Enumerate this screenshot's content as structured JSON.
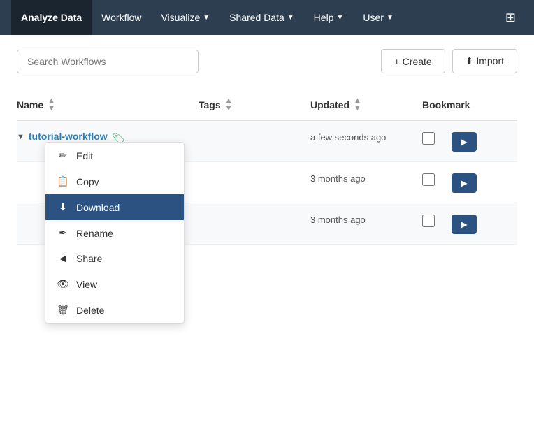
{
  "navbar": {
    "items": [
      {
        "label": "Analyze Data",
        "active": true
      },
      {
        "label": "Workflow",
        "active": false
      },
      {
        "label": "Visualize",
        "dropdown": true,
        "active": false
      },
      {
        "label": "Shared Data",
        "dropdown": true,
        "active": false
      },
      {
        "label": "Help",
        "dropdown": true,
        "active": false
      },
      {
        "label": "User",
        "dropdown": true,
        "active": false
      }
    ]
  },
  "toolbar": {
    "search_placeholder": "Search Workflows",
    "create_label": "+ Create",
    "import_label": "⬆ Import"
  },
  "table": {
    "columns": [
      {
        "label": "Name"
      },
      {
        "label": "Tags"
      },
      {
        "label": "Updated"
      },
      {
        "label": "Bookmark"
      }
    ],
    "rows": [
      {
        "name": "tutorial-workflow",
        "tags": "",
        "updated": "a few seconds ago",
        "bookmark": false
      },
      {
        "name": "",
        "tags": "",
        "updated": "3 months ago",
        "bookmark": false
      },
      {
        "name": "",
        "tags": "",
        "updated": "3 months ago",
        "bookmark": false
      }
    ]
  },
  "dropdown": {
    "items": [
      {
        "label": "Edit",
        "icon": "✏",
        "active": false
      },
      {
        "label": "Copy",
        "icon": "📋",
        "active": false
      },
      {
        "label": "Download",
        "icon": "⬇",
        "active": true
      },
      {
        "label": "Rename",
        "icon": "✒",
        "active": false
      },
      {
        "label": "Share",
        "icon": "◀",
        "active": false
      },
      {
        "label": "View",
        "icon": "👁",
        "active": false
      },
      {
        "label": "Delete",
        "icon": "🗑",
        "active": false
      }
    ]
  }
}
